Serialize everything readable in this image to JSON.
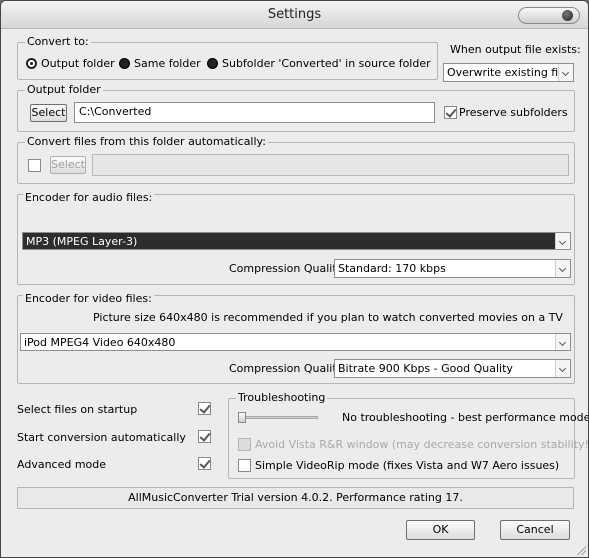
{
  "window": {
    "title": "Settings"
  },
  "convert_to": {
    "label": "Convert to:",
    "options": [
      "Output folder",
      "Same folder",
      "Subfolder 'Converted' in source folder"
    ],
    "selected": 0
  },
  "output_exists": {
    "label": "When output file exists:",
    "value": "Overwrite existing file"
  },
  "output_folder": {
    "label": "Output folder",
    "select_label": "Select",
    "path": "C:\\Converted",
    "preserve_label": "Preserve subfolders",
    "preserve_checked": true
  },
  "auto_folder": {
    "label": "Convert files from this folder automatically:",
    "select_label": "Select",
    "path": "",
    "enabled": false
  },
  "audio": {
    "label": "Encoder for audio files:",
    "encoder": "MP3 (MPEG Layer-3)",
    "quality_label": "Compression Quality",
    "quality": "Standard: 170 kbps"
  },
  "video": {
    "label": "Encoder for video files:",
    "hint": "Picture size 640x480 is recommended if you plan to watch converted movies on a TV",
    "encoder": "iPod MPEG4 Video 640x480",
    "quality_label": "Compression Quality",
    "quality": "Bitrate 900 Kbps - Good Quality"
  },
  "options": {
    "select_on_startup": {
      "label": "Select files on startup",
      "checked": true
    },
    "start_auto": {
      "label": "Start conversion automatically",
      "checked": true
    },
    "advanced": {
      "label": "Advanced mode",
      "checked": true
    }
  },
  "troubleshooting": {
    "label": "Troubleshooting",
    "level_text": "No troubleshooting - best performance mode",
    "level": 0,
    "avoid_vista": {
      "label": "Avoid Vista R&R window (may decrease conversion stability!)",
      "checked": false,
      "enabled": false
    },
    "simple_rip": {
      "label": "Simple VideoRip mode (fixes Vista and W7 Aero issues)",
      "checked": false
    }
  },
  "status": {
    "text": "AllMusicConverter Trial version 4.0.2. Performance rating 17."
  },
  "buttons": {
    "ok": "OK",
    "cancel": "Cancel"
  },
  "colors": {
    "window_bg": "#ececec",
    "selected_item_bg": "#2d2d2d"
  }
}
